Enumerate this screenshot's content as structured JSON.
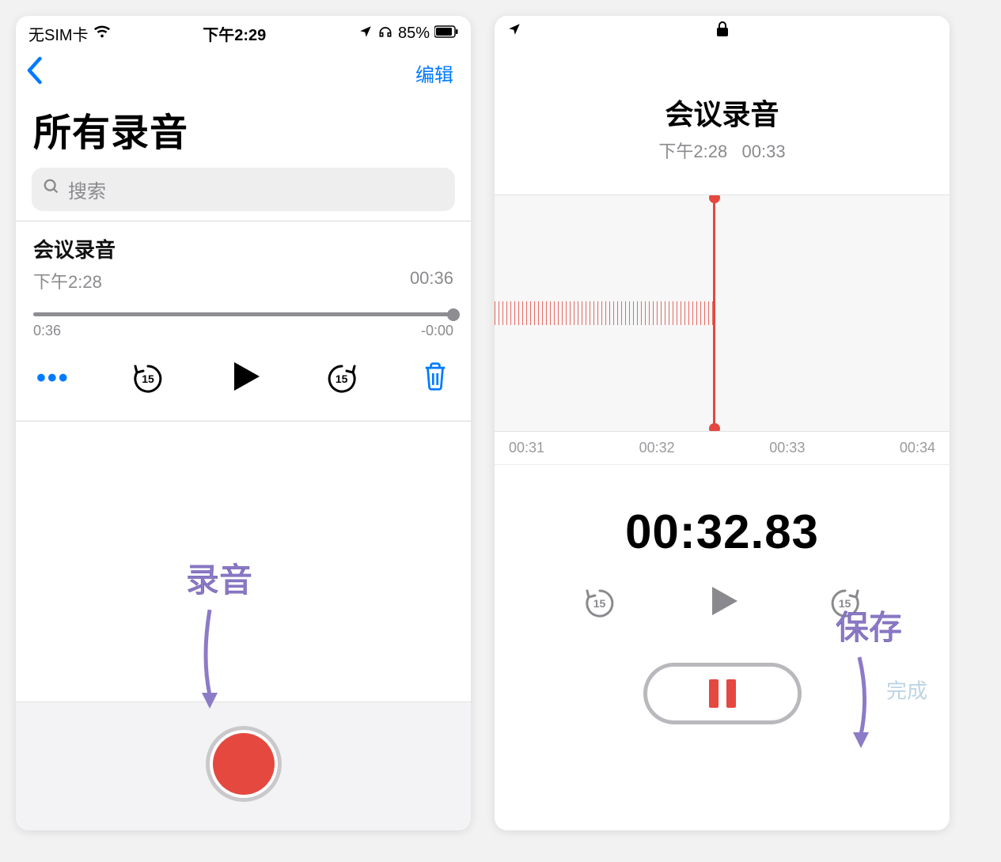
{
  "left": {
    "status": {
      "carrier": "无SIM卡",
      "time": "下午2:29",
      "battery": "85%"
    },
    "nav": {
      "edit": "编辑"
    },
    "title": "所有录音",
    "search": {
      "placeholder": "搜索"
    },
    "item": {
      "title": "会议录音",
      "time": "下午2:28",
      "duration": "00:36",
      "elapsed": "0:36",
      "remaining": "-0:00",
      "skipAmount": "15"
    },
    "annotation": "录音"
  },
  "right": {
    "header": {
      "title": "会议录音",
      "time": "下午2:28",
      "dur": "00:33"
    },
    "ruler": [
      "00:31",
      "00:32",
      "00:33",
      "00:34"
    ],
    "bigTime": "00:32.83",
    "skipAmount": "15",
    "done": "完成",
    "annotation": "保存"
  }
}
